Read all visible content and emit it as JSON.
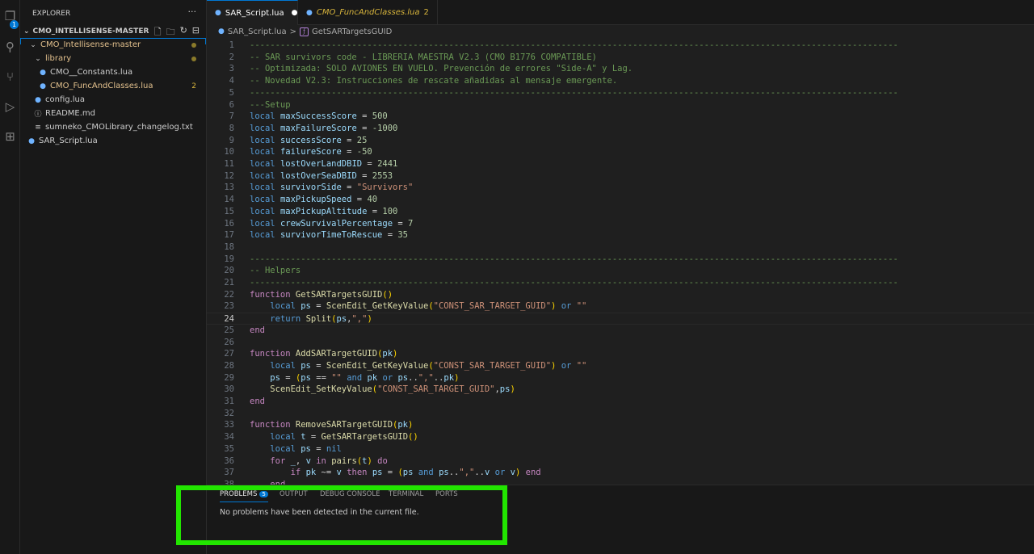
{
  "activity_bar": {
    "items": [
      {
        "icon": "explorer-icon",
        "badge": "1"
      },
      {
        "icon": "search-icon"
      },
      {
        "icon": "source-control-icon"
      },
      {
        "icon": "run-debug-icon"
      },
      {
        "icon": "extensions-icon"
      }
    ]
  },
  "sidebar": {
    "title": "EXPLORER",
    "more": "···",
    "root": "CMO_INTELLISENSE-MASTER",
    "items": [
      {
        "label": "CMO_Intellisense-master",
        "type": "folder",
        "modified": true
      },
      {
        "label": "library",
        "type": "folder",
        "modified": true
      },
      {
        "label": "CMO__Constants.lua",
        "type": "lua"
      },
      {
        "label": "CMO_FuncAndClasses.lua",
        "type": "lua",
        "count": "2"
      },
      {
        "label": "config.lua",
        "type": "lua"
      },
      {
        "label": "README.md",
        "type": "info"
      },
      {
        "label": "sumneko_CMOLibrary_changelog.txt",
        "type": "txt"
      },
      {
        "label": "SAR_Script.lua",
        "type": "lua"
      }
    ]
  },
  "tabs": [
    {
      "label": "SAR_Script.lua",
      "dirty": "●"
    },
    {
      "label": "CMO_FuncAndClasses.lua",
      "count": "2"
    }
  ],
  "breadcrumb": {
    "file": "SAR_Script.lua",
    "sep": ">",
    "symbol": "GetSARTargetsGUID"
  },
  "editor": {
    "current_line": 24,
    "lines": [
      "-------------------------------------------------------------------------------------------------------------------------------",
      "-- SAR survivors code - LIBRERIA MAESTRA V2.3 (CMO B1776 COMPATIBLE)",
      "-- Optimizada: SOLO AVIONES EN VUELO. Prevención de errores \"Side-A\" y Lag.",
      "-- Novedad V2.3: Instrucciones de rescate añadidas al mensaje emergente.",
      "-------------------------------------------------------------------------------------------------------------------------------",
      "---Setup",
      "local maxSuccessScore = 500",
      "local maxFailureScore = -1000",
      "local successScore = 25",
      "local failureScore = -50",
      "local lostOverLandDBID = 2441",
      "local lostOverSeaDBID = 2553",
      "local survivorSide = \"Survivors\"",
      "local maxPickupSpeed = 40",
      "local maxPickupAltitude = 100",
      "local crewSurvivalPercentage = 7",
      "local survivorTimeToRescue = 35",
      "",
      "-------------------------------------------------------------------------------------------------------------------------------",
      "-- Helpers",
      "-------------------------------------------------------------------------------------------------------------------------------",
      "function GetSARTargetsGUID()",
      "    local ps = ScenEdit_GetKeyValue(\"CONST_SAR_TARGET_GUID\") or \"\"",
      "    return Split(ps,\",\")",
      "end",
      "",
      "function AddSARTargetGUID(pk)",
      "    local ps = ScenEdit_GetKeyValue(\"CONST_SAR_TARGET_GUID\") or \"\"",
      "    ps = (ps == \"\" and pk or ps..\",\"..pk)",
      "    ScenEdit_SetKeyValue(\"CONST_SAR_TARGET_GUID\",ps)",
      "end",
      "",
      "function RemoveSARTargetGUID(pk)",
      "    local t = GetSARTargetsGUID()",
      "    local ps = nil",
      "    for _, v in pairs(t) do",
      "        if pk ~= v then ps = (ps and ps..\",\"..v or v) end",
      "    end"
    ]
  },
  "panel": {
    "tabs": [
      {
        "label": "PROBLEMS",
        "badge": "5"
      },
      {
        "label": "OUTPUT"
      },
      {
        "label": "DEBUG CONSOLE"
      },
      {
        "label": "TERMINAL"
      },
      {
        "label": "PORTS"
      }
    ],
    "message": "No problems have been detected in the current file."
  },
  "colors": {
    "accent": "#0078d4",
    "annotation_box": "#22e500"
  }
}
